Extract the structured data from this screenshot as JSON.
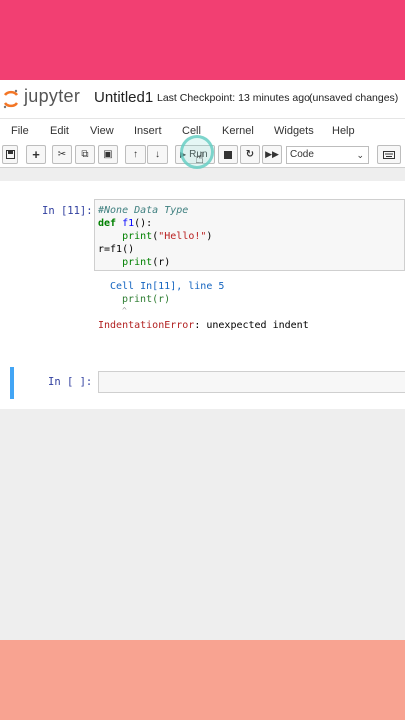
{
  "app": {
    "logo_text": "jupyter",
    "notebook_title": "Untitled1",
    "checkpoint": "Last Checkpoint: 13 minutes ago",
    "unsaved": "(unsaved changes)"
  },
  "menu": [
    "File",
    "Edit",
    "View",
    "Insert",
    "Cell",
    "Kernel",
    "Widgets",
    "Help"
  ],
  "toolbar": {
    "run_label": "Run",
    "cell_type": "Code"
  },
  "cells": [
    {
      "prompt": "In [11]:",
      "code": {
        "line1": "#None Data Type",
        "line2_kw": "def",
        "line2_fn": " f1",
        "line2_rest": "():",
        "line3_indent": "    ",
        "line3_fn": "print",
        "line3_open": "(",
        "line3_str": "\"Hello!\"",
        "line3_close": ")",
        "line4": "r=f1()",
        "line5_indent": "    ",
        "line5_fn": "print",
        "line5_rest": "(r)"
      },
      "output": {
        "trace_line1": "Cell In[11], line 5",
        "trace_line2": "print(r)",
        "trace_line3": "^",
        "error_name": "IndentationError",
        "error_msg": ": unexpected indent"
      }
    },
    {
      "prompt": "In [ ]:"
    }
  ],
  "colors": {
    "top_band": "#f23f72",
    "bottom_band": "#f8a391",
    "selected_cell_border": "#42a5f5",
    "run_highlight": "#64cdc3"
  }
}
